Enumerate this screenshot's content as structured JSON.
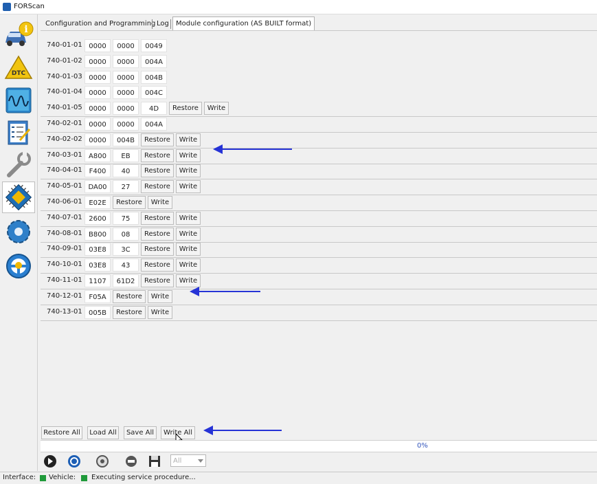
{
  "app_title": "FORScan",
  "tabs": [
    {
      "label": "Configuration and Programming"
    },
    {
      "label": "Log"
    },
    {
      "label": "Module configuration (AS BUILT format)"
    }
  ],
  "rows": [
    {
      "label": "740-01-01",
      "cells": [
        "0000",
        "0000",
        "0049"
      ],
      "buttons": []
    },
    {
      "label": "740-01-02",
      "cells": [
        "0000",
        "0000",
        "004A"
      ],
      "buttons": []
    },
    {
      "label": "740-01-03",
      "cells": [
        "0000",
        "0000",
        "004B"
      ],
      "buttons": []
    },
    {
      "label": "740-01-04",
      "cells": [
        "0000",
        "0000",
        "004C"
      ],
      "buttons": []
    },
    {
      "label": "740-01-05",
      "cells": [
        "0000",
        "0000",
        "4D"
      ],
      "buttons": [
        "Restore",
        "Write"
      ]
    },
    {
      "label": "740-02-01",
      "cells": [
        "0000",
        "0000",
        "004A"
      ],
      "buttons": []
    },
    {
      "label": "740-02-02",
      "cells": [
        "0000",
        "004B"
      ],
      "buttons": [
        "Restore",
        "Write"
      ]
    },
    {
      "label": "740-03-01",
      "cells": [
        "A800",
        "EB"
      ],
      "buttons": [
        "Restore",
        "Write"
      ]
    },
    {
      "label": "740-04-01",
      "cells": [
        "F400",
        "40"
      ],
      "buttons": [
        "Restore",
        "Write"
      ]
    },
    {
      "label": "740-05-01",
      "cells": [
        "DA00",
        "27"
      ],
      "buttons": [
        "Restore",
        "Write"
      ]
    },
    {
      "label": "740-06-01",
      "cells": [
        "E02E"
      ],
      "buttons": [
        "Restore",
        "Write"
      ]
    },
    {
      "label": "740-07-01",
      "cells": [
        "2600",
        "75"
      ],
      "buttons": [
        "Restore",
        "Write"
      ]
    },
    {
      "label": "740-08-01",
      "cells": [
        "B800",
        "08"
      ],
      "buttons": [
        "Restore",
        "Write"
      ]
    },
    {
      "label": "740-09-01",
      "cells": [
        "03E8",
        "3C"
      ],
      "buttons": [
        "Restore",
        "Write"
      ]
    },
    {
      "label": "740-10-01",
      "cells": [
        "03E8",
        "43"
      ],
      "buttons": [
        "Restore",
        "Write"
      ]
    },
    {
      "label": "740-11-01",
      "cells": [
        "1107",
        "61D2"
      ],
      "buttons": [
        "Restore",
        "Write"
      ]
    },
    {
      "label": "740-12-01",
      "cells": [
        "F05A"
      ],
      "buttons": [
        "Restore",
        "Write"
      ]
    },
    {
      "label": "740-13-01",
      "cells": [
        "005B"
      ],
      "buttons": [
        "Restore",
        "Write"
      ]
    }
  ],
  "bottom_buttons": [
    "Restore All",
    "Load All",
    "Save All",
    "Write All"
  ],
  "progress": {
    "text": "0%",
    "value": 0
  },
  "toolbar": {
    "combo_value": "All"
  },
  "status": {
    "interface_label": "Interface:",
    "vehicle_label": "Vehicle:",
    "message": "Executing service procedure..."
  },
  "sidebar": [
    "info-car-icon",
    "dtc-icon",
    "oscilloscope-icon",
    "checklist-icon",
    "wrench-icon",
    "chip-icon",
    "gear-icon",
    "steering-wheel-icon"
  ],
  "colors": {
    "arrow": "#2633d6",
    "led": "#1f9a3a",
    "accent": "#1f5fb0"
  }
}
